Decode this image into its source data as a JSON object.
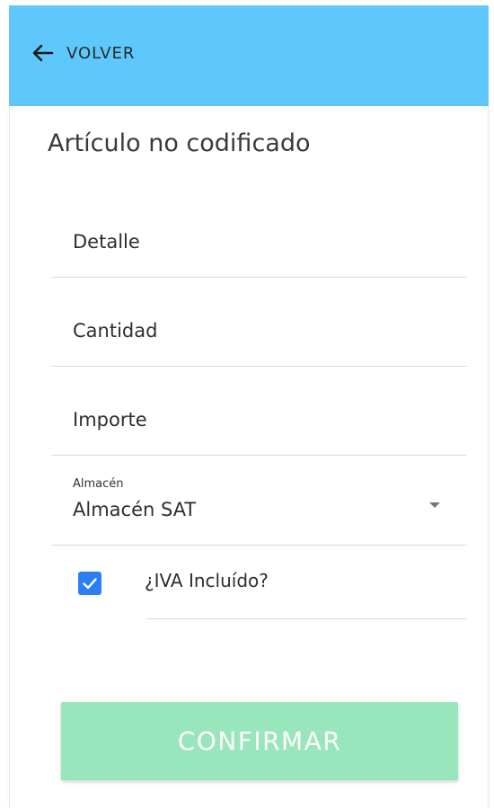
{
  "header": {
    "back_label": "VOLVER",
    "background_color": "#5ec8fc",
    "back_icon": "arrow-left-icon"
  },
  "form": {
    "title": "Artículo no codificado",
    "fields": [
      {
        "placeholder": "Detalle",
        "value": ""
      },
      {
        "placeholder": "Cantidad",
        "value": ""
      },
      {
        "placeholder": "Importe",
        "value": ""
      }
    ],
    "warehouse": {
      "label": "Almacén",
      "value": "Almacén SAT",
      "icon": "caret-down-icon"
    },
    "iva": {
      "label": "¿IVA Incluído?",
      "checked": true,
      "color": "#2d7ff1"
    },
    "confirm": {
      "label": "CONFIRMAR",
      "color": "#99e6bd"
    }
  }
}
